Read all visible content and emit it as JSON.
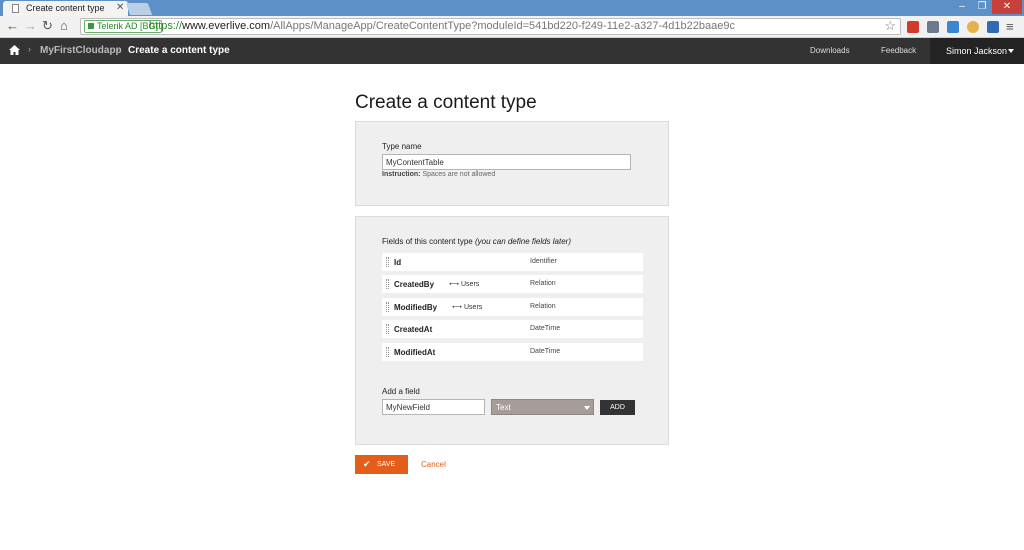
{
  "browser": {
    "tab_title": "Create content type",
    "cert_label": "Telerik AD [BG]",
    "url_scheme": "https://",
    "url_host": "www.everlive.com",
    "url_path": "/AllApps/ManageApp/CreateContentType?moduleId=541bd220-f249-11e2-a327-4d1b22baae9c"
  },
  "appbar": {
    "breadcrumb_app": "MyFirstCloudapp",
    "breadcrumb_current": "Create a content type",
    "downloads": "Downloads",
    "feedback": "Feedback",
    "user_name": "Simon Jackson"
  },
  "page": {
    "title": "Create a content type",
    "type_name_label": "Type name",
    "type_name_value": "MyContentTable",
    "instruction_bold": "Instruction:",
    "instruction_text": "Spaces are not allowed",
    "fields_heading": "Fields of this content type",
    "fields_heading_note": "(you can define fields later)",
    "fields": [
      {
        "name": "Id",
        "relation": "",
        "type": "Identifier"
      },
      {
        "name": "CreatedBy",
        "relation": "Users",
        "type": "Relation"
      },
      {
        "name": "ModifiedBy",
        "relation": "Users",
        "type": "Relation"
      },
      {
        "name": "CreatedAt",
        "relation": "",
        "type": "DateTime"
      },
      {
        "name": "ModifiedAt",
        "relation": "",
        "type": "DateTime"
      }
    ],
    "add_field_label": "Add a field",
    "new_field_value": "MyNewField",
    "new_field_type": "Text",
    "add_button": "ADD",
    "save_button": "SAVE",
    "cancel_link": "Cancel"
  },
  "colors": {
    "accent": "#e35e1b",
    "appbar": "#333333",
    "panel": "#efefef"
  }
}
